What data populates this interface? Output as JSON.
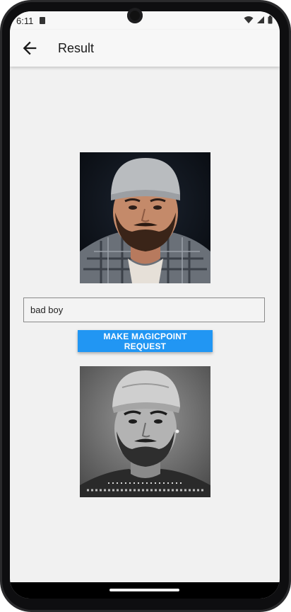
{
  "status_bar": {
    "time": "6:11"
  },
  "app_bar": {
    "title": "Result"
  },
  "input": {
    "value": "bad boy"
  },
  "button": {
    "label": "MAKE MAGICPOINT REQUEST"
  },
  "colors": {
    "accent": "#2196f3",
    "background": "#f1f1f1"
  },
  "icons": [
    "sd-card-icon",
    "wifi-icon",
    "signal-icon",
    "battery-icon",
    "back-arrow-icon"
  ],
  "images": {
    "input_photo": "color-photo-man-beanie",
    "result_photo": "grayscale-portrait-man-cap"
  }
}
